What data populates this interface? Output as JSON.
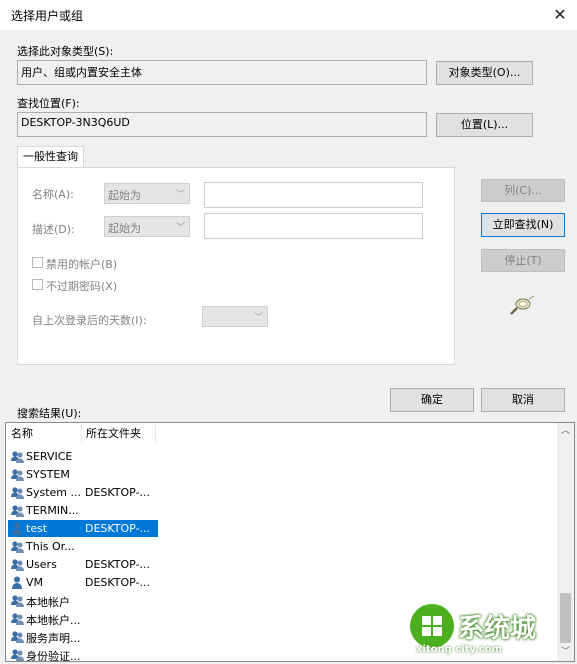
{
  "window": {
    "title": "选择用户或组"
  },
  "object_type": {
    "label": "选择此对象类型(S):",
    "value": "用户、组或内置安全主体",
    "button": "对象类型(O)..."
  },
  "location": {
    "label": "查找位置(F):",
    "value": "DESKTOP-3N3Q6UD",
    "button": "位置(L)..."
  },
  "tab": {
    "label": "一般性查询"
  },
  "query": {
    "name_label": "名称(A):",
    "name_combo": "起始为",
    "desc_label": "描述(D):",
    "desc_combo": "起始为",
    "disabled_accounts": "禁用的帐户(B)",
    "non_expiring": "不过期密码(X)",
    "days_label": "自上次登录后的天数(I):"
  },
  "side_buttons": {
    "columns": "列(C)...",
    "find_now": "立即查找(N)",
    "stop": "停止(T)"
  },
  "bottom_buttons": {
    "ok": "确定",
    "cancel": "取消"
  },
  "results": {
    "label": "搜索结果(U):",
    "columns": [
      "名称",
      "所在文件夹"
    ],
    "rows": [
      {
        "name": "SERVICE",
        "folder": "",
        "icon": "group-icon"
      },
      {
        "name": "SYSTEM",
        "folder": "",
        "icon": "group-icon"
      },
      {
        "name": "System ...",
        "folder": "DESKTOP-...",
        "icon": "group-icon"
      },
      {
        "name": "TERMIN...",
        "folder": "",
        "icon": "group-icon"
      },
      {
        "name": "test",
        "folder": "DESKTOP-...",
        "icon": "user-icon",
        "selected": true
      },
      {
        "name": "This Or...",
        "folder": "",
        "icon": "group-icon"
      },
      {
        "name": "Users",
        "folder": "DESKTOP-...",
        "icon": "group-icon"
      },
      {
        "name": "VM",
        "folder": "DESKTOP-...",
        "icon": "user-icon"
      },
      {
        "name": "本地帐户",
        "folder": "",
        "icon": "group-icon"
      },
      {
        "name": "本地帐户...",
        "folder": "",
        "icon": "group-icon"
      },
      {
        "name": "服务声明...",
        "folder": "",
        "icon": "group-icon"
      },
      {
        "name": "身份验证...",
        "folder": "",
        "icon": "group-icon"
      }
    ]
  },
  "watermark": {
    "brand": "系统城",
    "url": "xitong city.com"
  },
  "colors": {
    "selection": "#0078d7",
    "dialog_bg": "#f0f0f0"
  }
}
